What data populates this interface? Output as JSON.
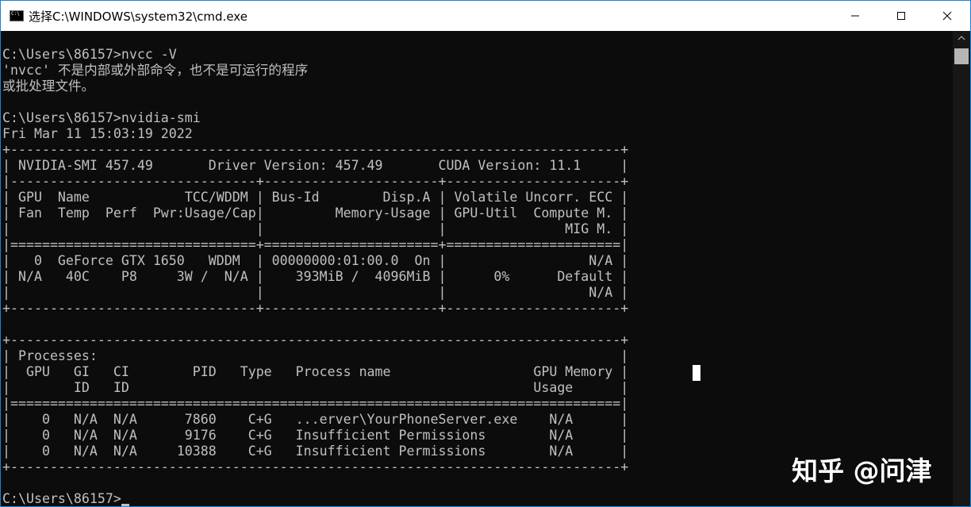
{
  "window": {
    "title": "选择C:\\WINDOWS\\system32\\cmd.exe",
    "icon_glyph": "C:\\",
    "icons": {
      "app": "cmd-app-icon",
      "minimize": "minimize-icon",
      "maximize": "maximize-icon",
      "close": "close-icon"
    }
  },
  "colors": {
    "console_background": "#0c0c0c",
    "console_text": "#c0c0c0",
    "titlebar_background": "#ffffff",
    "window_border": "#1883d7"
  },
  "console": {
    "lines": [
      "C:\\Users\\86157>nvcc -V",
      "'nvcc' 不是内部或外部命令，也不是可运行的程序",
      "或批处理文件。",
      "",
      "C:\\Users\\86157>nvidia-smi",
      "Fri Mar 11 15:03:19 2022",
      "+-----------------------------------------------------------------------------+",
      "| NVIDIA-SMI 457.49       Driver Version: 457.49       CUDA Version: 11.1     |",
      "|-------------------------------+----------------------+----------------------+",
      "| GPU  Name            TCC/WDDM | Bus-Id        Disp.A | Volatile Uncorr. ECC |",
      "| Fan  Temp  Perf  Pwr:Usage/Cap|         Memory-Usage | GPU-Util  Compute M. |",
      "|                               |                      |               MIG M. |",
      "|===============================+======================+======================|",
      "|   0  GeForce GTX 1650   WDDM  | 00000000:01:00.0  On |                  N/A |",
      "| N/A   40C    P8     3W /  N/A |    393MiB /  4096MiB |      0%      Default |",
      "|                               |                      |                  N/A |",
      "+-------------------------------+----------------------+----------------------+",
      "",
      "+-----------------------------------------------------------------------------+",
      "| Processes:                                                                  |",
      "|  GPU   GI   CI        PID   Type   Process name                  GPU Memory |",
      "|        ID   ID                                                   Usage      |",
      "|=============================================================================|",
      "|    0   N/A  N/A      7860    C+G   ...erver\\YourPhoneServer.exe    N/A      |",
      "|    0   N/A  N/A      9176    C+G   Insufficient Permissions        N/A      |",
      "|    0   N/A  N/A     10388    C+G   Insufficient Permissions        N/A      |",
      "+-----------------------------------------------------------------------------+",
      "",
      "C:\\Users\\86157>"
    ]
  },
  "watermark": {
    "text": "知乎 @问津"
  }
}
